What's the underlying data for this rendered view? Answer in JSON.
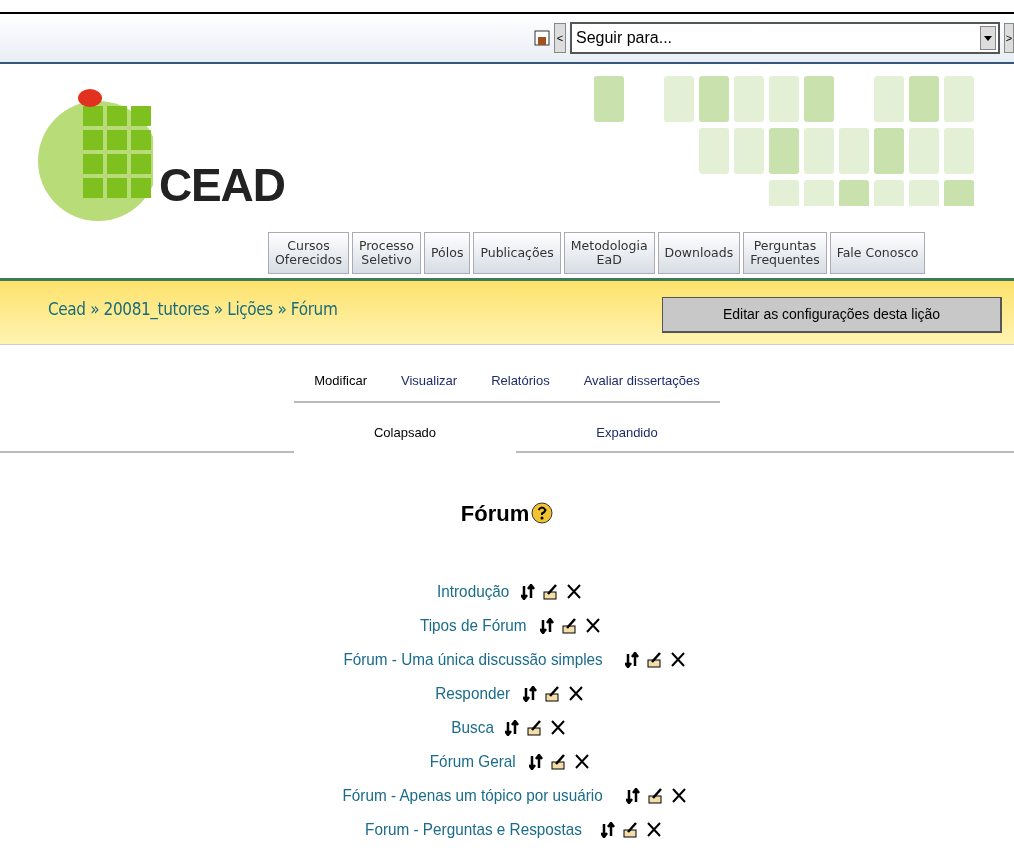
{
  "jump_menu": {
    "prev": "<",
    "value": "Seguir para...",
    "next": ">"
  },
  "logo": {
    "text": "CEAD"
  },
  "nav_tabs": [
    "Cursos\nOferecidos",
    "Processo\nSeletivo",
    "Pólos",
    "Publicações",
    "Metodologia\nEaD",
    "Downloads",
    "Perguntas\nFrequentes",
    "Fale Conosco"
  ],
  "breadcrumb": "Cead » 20081_tutores » Lições » Fórum",
  "edit_button": "Editar as configurações desta lição",
  "tabs": [
    {
      "label": "Modificar",
      "selected": true
    },
    {
      "label": "Visualizar",
      "selected": false
    },
    {
      "label": "Relatórios",
      "selected": false
    },
    {
      "label": "Avaliar dissertações",
      "selected": false
    }
  ],
  "subtabs": [
    {
      "label": "Colapsado",
      "selected": true
    },
    {
      "label": "Expandido",
      "selected": false
    }
  ],
  "title": "Fórum",
  "pages": [
    "Introdução",
    "Tipos de Fórum",
    "Fórum - Uma única discussão simples",
    "Responder",
    "Busca",
    "Fórum Geral",
    "Fórum - Apenas um tópico por usuário",
    "Forum - Perguntas e Respostas"
  ]
}
